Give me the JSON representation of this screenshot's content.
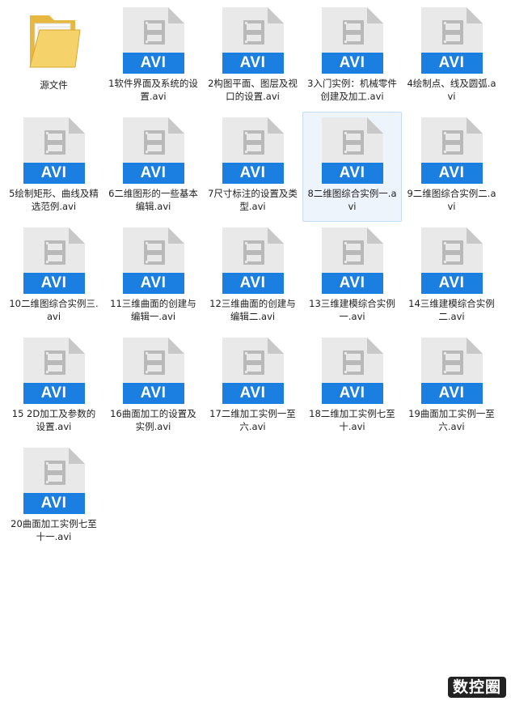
{
  "folder": {
    "label": "源文件",
    "icon": "folder-icon"
  },
  "file_badge": "AVI",
  "files": [
    {
      "label": "1软件界面及系统的设置.avi"
    },
    {
      "label": "2构图平面、图层及视口的设置.avi"
    },
    {
      "label": "3入门实例：机械零件创建及加工.avi"
    },
    {
      "label": "4绘制点、线及圆弧.avi"
    },
    {
      "label": "5绘制矩形、曲线及精选范例.avi"
    },
    {
      "label": "6二维图形的一些基本编辑.avi"
    },
    {
      "label": "7尺寸标注的设置及类型.avi"
    },
    {
      "label": "8二维图综合实例一.avi",
      "selected": true
    },
    {
      "label": "9二维图综合实例二.avi"
    },
    {
      "label": "10二维图综合实例三.avi"
    },
    {
      "label": "11三维曲面的创建与编辑一.avi"
    },
    {
      "label": "12三维曲面的创建与编辑二.avi"
    },
    {
      "label": "13三维建模综合实例一.avi"
    },
    {
      "label": "14三维建模综合实例二.avi"
    },
    {
      "label": "15 2D加工及参数的设置.avi"
    },
    {
      "label": "16曲面加工的设置及实例.avi"
    },
    {
      "label": "17二维加工实例一至六.avi"
    },
    {
      "label": "18二维加工实例七至十.avi"
    },
    {
      "label": "19曲面加工实例一至六.avi"
    },
    {
      "label": "20曲面加工实例七至十一.avi"
    }
  ],
  "watermark": "数控圈",
  "colors": {
    "badge": "#1a7fe0",
    "page": "#e9e9e9",
    "fold": "#c8c8c8",
    "glyph": "#b9b9b9",
    "selection": "#eef4fc"
  }
}
